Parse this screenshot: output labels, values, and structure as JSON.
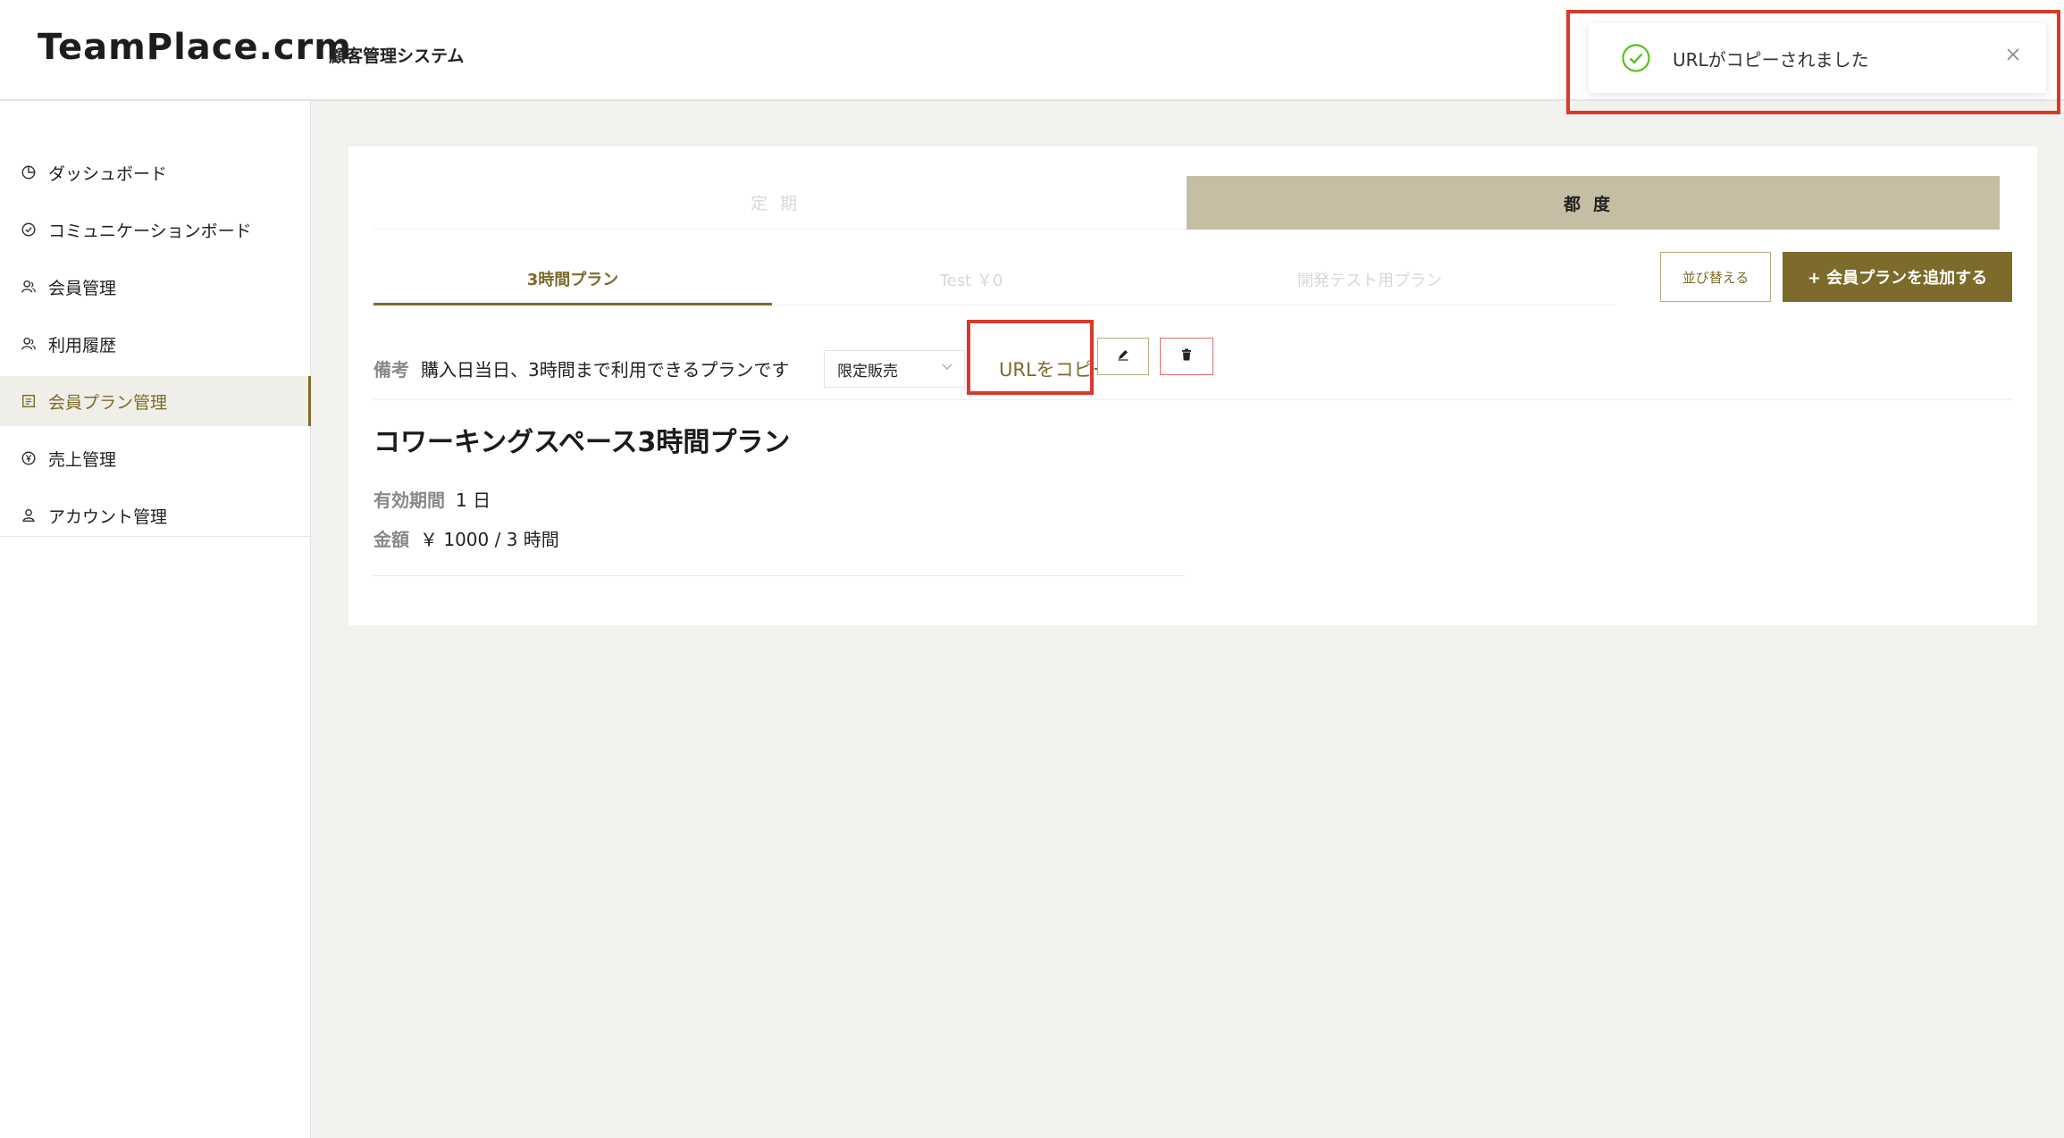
{
  "header": {
    "logo": "TeamPlace.crm",
    "subtitle": "顧客管理システム"
  },
  "sidebar": {
    "items": [
      {
        "label": "ダッシュボード",
        "icon": "dashboard-icon"
      },
      {
        "label": "コミュニケーションボード",
        "icon": "check-circle-icon"
      },
      {
        "label": "会員管理",
        "icon": "users-icon"
      },
      {
        "label": "利用履歴",
        "icon": "users-icon"
      },
      {
        "label": "会員プラン管理",
        "icon": "list-icon",
        "active": true
      },
      {
        "label": "売上管理",
        "icon": "yen-icon"
      },
      {
        "label": "アカウント管理",
        "icon": "account-icon"
      }
    ]
  },
  "type_tabs": [
    {
      "label": "定期"
    },
    {
      "label": "都度",
      "active": true
    }
  ],
  "plan_tabs": [
    {
      "label": "3時間プラン",
      "active": true
    },
    {
      "label": "Test ￥0"
    },
    {
      "label": "開発テスト用プラン"
    }
  ],
  "buttons": {
    "sort": "並び替える",
    "add": "+ 会員プランを追加する",
    "copy_url": "URLをコピー"
  },
  "note": {
    "label": "備考",
    "text": "購入日当日、3時間まで利用できるプランです"
  },
  "select": {
    "value": "限定販売"
  },
  "plan": {
    "title": "コワーキングスペース3時間プラン",
    "period_label": "有効期間",
    "period_value": "1 日",
    "price_label": "金額",
    "price_value": "￥ 1000 / 3 時間"
  },
  "toast": {
    "message": "URLがコピーされました"
  },
  "colors": {
    "accent": "#7c6b2a",
    "tab_active_bg": "#c5bea4",
    "highlight_red": "#d83a2a",
    "success_green": "#52c41a"
  }
}
